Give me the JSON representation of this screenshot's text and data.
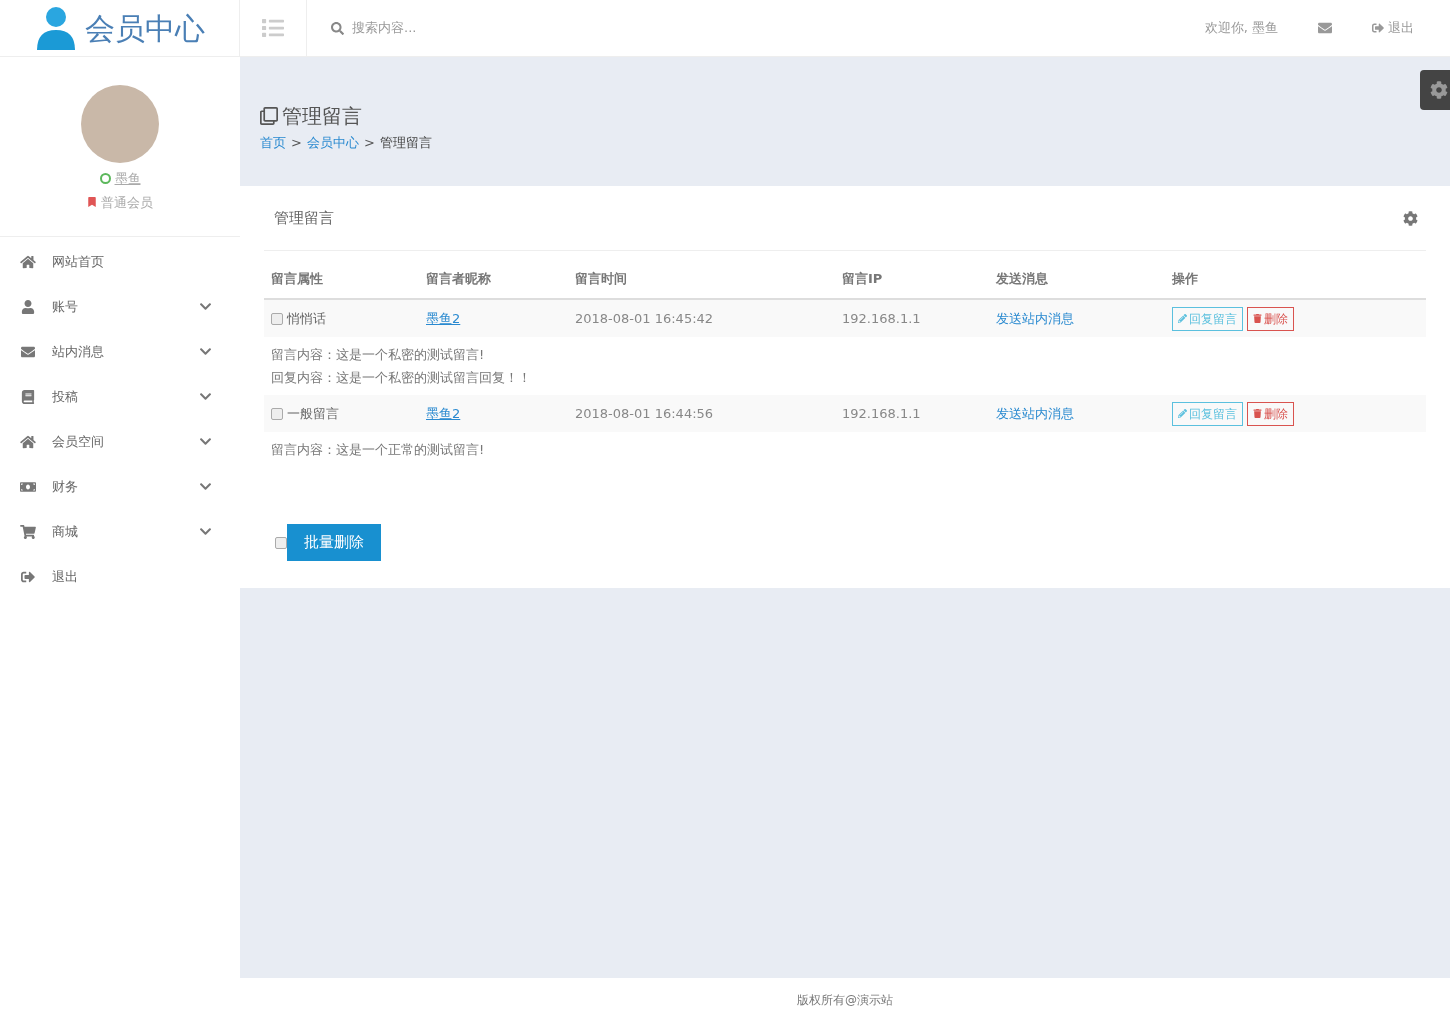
{
  "logo": {
    "text": "会员中心"
  },
  "search": {
    "placeholder": "搜索内容..."
  },
  "header": {
    "welcome": "欢迎你, 墨鱼",
    "logout": "退出"
  },
  "profile": {
    "name": "墨鱼",
    "level": "普通会员",
    "online": true
  },
  "sidebar": {
    "items": [
      {
        "label": "网站首页",
        "submenu": false
      },
      {
        "label": "账号",
        "submenu": true
      },
      {
        "label": "站内消息",
        "submenu": true
      },
      {
        "label": "投稿",
        "submenu": true
      },
      {
        "label": "会员空间",
        "submenu": true
      },
      {
        "label": "财务",
        "submenu": true
      },
      {
        "label": "商城",
        "submenu": true
      },
      {
        "label": "退出",
        "submenu": false
      }
    ]
  },
  "page": {
    "title": "管理留言",
    "breadcrumb": [
      {
        "kind": "link",
        "label": "首页"
      },
      {
        "kind": "separator",
        "label": ">"
      },
      {
        "kind": "link",
        "label": "会员中心"
      },
      {
        "kind": "separator",
        "label": ">"
      },
      {
        "kind": "current",
        "label": "管理留言"
      }
    ]
  },
  "panel": {
    "title": "管理留言",
    "columns": [
      "留言属性",
      "留言者昵称",
      "留言时间",
      "留言IP",
      "发送消息",
      "操作"
    ],
    "rows": [
      {
        "checked": false,
        "type": "悄悄话",
        "nickname": "墨鱼2",
        "time": "2018-08-01 16:45:42",
        "ip": "192.168.1.1",
        "message_link": "发送站内消息",
        "reply_button": "回复留言",
        "delete_button": "删除",
        "content": [
          "留言内容：这是一个私密的测试留言!",
          "回复内容：这是一个私密的测试留言回复！！"
        ]
      },
      {
        "checked": false,
        "type": "一般留言",
        "nickname": "墨鱼2",
        "time": "2018-08-01 16:44:56",
        "ip": "192.168.1.1",
        "message_link": "发送站内消息",
        "reply_button": "回复留言",
        "delete_button": "删除",
        "content": [
          "留言内容：这是一个正常的测试留言!"
        ]
      }
    ],
    "select_all": {
      "checked": false
    },
    "batch_delete": "批量删除"
  },
  "footer": "版权所有@演示站"
}
